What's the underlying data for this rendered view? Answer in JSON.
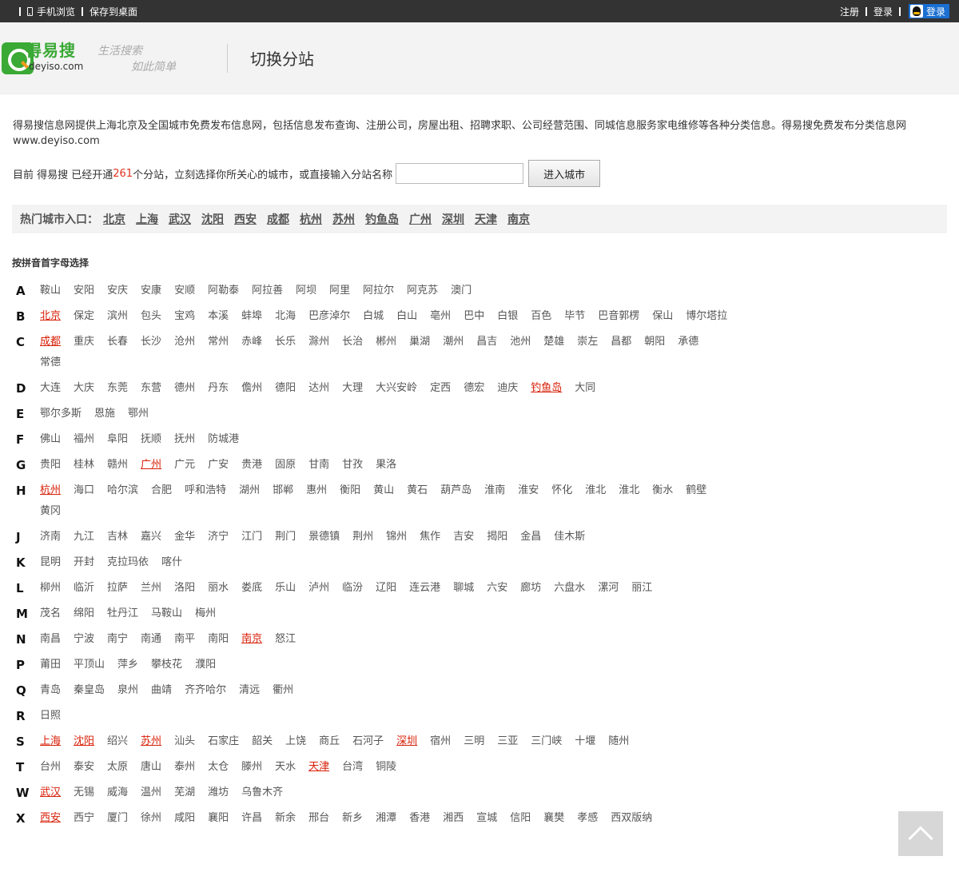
{
  "topbar": {
    "mobile": "手机浏览",
    "save_desktop": "保存到桌面",
    "register": "注册",
    "login": "登录",
    "qq_login": "登录"
  },
  "header": {
    "logo_cn": "得易搜",
    "logo_en": "deyiso.com",
    "slogan_line1": "生活搜索",
    "slogan_line2": "如此简单",
    "title": "切换分站"
  },
  "intro": {
    "text": "得易搜信息网提供上海北京及全国城市免费发布信息网，包括信息发布查询、注册公司，房屋出租、招聘求职、公司经营范围、同城信息服务家电维修等各种分类信息。得易搜免费发布分类信息网www.deyiso.com"
  },
  "search": {
    "prefix": "目前 得易搜 已经开通",
    "count": "261",
    "suffix": "个分站，立刻选择你所关心的城市，或直接输入分站名称",
    "button": "进入城市",
    "value": ""
  },
  "hot": {
    "label": "热门城市入口：",
    "cities": [
      "北京",
      "上海",
      "武汉",
      "沈阳",
      "西安",
      "成都",
      "杭州",
      "苏州",
      "钓鱼岛",
      "广州",
      "深圳",
      "天津",
      "南京"
    ]
  },
  "section_title": "按拼音首字母选择",
  "letters": [
    {
      "letter": "A",
      "cities": [
        "鞍山",
        "安阳",
        "安庆",
        "安康",
        "安顺",
        "阿勒泰",
        "阿拉善",
        "阿坝",
        "阿里",
        "阿拉尔",
        "阿克苏",
        "澳门"
      ]
    },
    {
      "letter": "B",
      "cities": [
        "北京*",
        "保定",
        "滨州",
        "包头",
        "宝鸡",
        "本溪",
        "蚌埠",
        "北海",
        "巴彦淖尔",
        "白城",
        "白山",
        "亳州",
        "巴中",
        "白银",
        "百色",
        "毕节",
        "巴音郭楞",
        "保山",
        "博尔塔拉"
      ]
    },
    {
      "letter": "C",
      "cities": [
        "成都*",
        "重庆",
        "长春",
        "长沙",
        "沧州",
        "常州",
        "赤峰",
        "长乐",
        "滁州",
        "长治",
        "郴州",
        "巢湖",
        "潮州",
        "昌吉",
        "池州",
        "楚雄",
        "崇左",
        "昌都",
        "朝阳",
        "承德",
        "常德"
      ]
    },
    {
      "letter": "D",
      "cities": [
        "大连",
        "大庆",
        "东莞",
        "东营",
        "德州",
        "丹东",
        "儋州",
        "德阳",
        "达州",
        "大理",
        "大兴安岭",
        "定西",
        "德宏",
        "迪庆",
        "钓鱼岛*",
        "大同"
      ]
    },
    {
      "letter": "E",
      "cities": [
        "鄂尔多斯",
        "恩施",
        "鄂州"
      ]
    },
    {
      "letter": "F",
      "cities": [
        "佛山",
        "福州",
        "阜阳",
        "抚顺",
        "抚州",
        "防城港"
      ]
    },
    {
      "letter": "G",
      "cities": [
        "贵阳",
        "桂林",
        "赣州",
        "广州*",
        "广元",
        "广安",
        "贵港",
        "固原",
        "甘南",
        "甘孜",
        "果洛"
      ]
    },
    {
      "letter": "H",
      "cities": [
        "杭州*",
        "海口",
        "哈尔滨",
        "合肥",
        "呼和浩特",
        "湖州",
        "邯郸",
        "惠州",
        "衡阳",
        "黄山",
        "黄石",
        "葫芦岛",
        "淮南",
        "淮安",
        "怀化",
        "淮北",
        "淮北",
        "衡水",
        "鹤壁",
        "黄冈"
      ]
    },
    {
      "letter": "J",
      "cities": [
        "济南",
        "九江",
        "吉林",
        "嘉兴",
        "金华",
        "济宁",
        "江门",
        "荆门",
        "景德镇",
        "荆州",
        "锦州",
        "焦作",
        "吉安",
        "揭阳",
        "金昌",
        "佳木斯"
      ]
    },
    {
      "letter": "K",
      "cities": [
        "昆明",
        "开封",
        "克拉玛依",
        "喀什"
      ]
    },
    {
      "letter": "L",
      "cities": [
        "柳州",
        "临沂",
        "拉萨",
        "兰州",
        "洛阳",
        "丽水",
        "娄底",
        "乐山",
        "泸州",
        "临汾",
        "辽阳",
        "连云港",
        "聊城",
        "六安",
        "廊坊",
        "六盘水",
        "漯河",
        "丽江"
      ]
    },
    {
      "letter": "M",
      "cities": [
        "茂名",
        "绵阳",
        "牡丹江",
        "马鞍山",
        "梅州"
      ]
    },
    {
      "letter": "N",
      "cities": [
        "南昌",
        "宁波",
        "南宁",
        "南通",
        "南平",
        "南阳",
        "南京*",
        "怒江"
      ]
    },
    {
      "letter": "P",
      "cities": [
        "莆田",
        "平顶山",
        "萍乡",
        "攀枝花",
        "濮阳"
      ]
    },
    {
      "letter": "Q",
      "cities": [
        "青岛",
        "秦皇岛",
        "泉州",
        "曲靖",
        "齐齐哈尔",
        "清远",
        "衢州"
      ]
    },
    {
      "letter": "R",
      "cities": [
        "日照"
      ]
    },
    {
      "letter": "S",
      "cities": [
        "上海*",
        "沈阳*",
        "绍兴",
        "苏州*",
        "汕头",
        "石家庄",
        "韶关",
        "上饶",
        "商丘",
        "石河子",
        "深圳*",
        "宿州",
        "三明",
        "三亚",
        "三门峡",
        "十堰",
        "随州"
      ]
    },
    {
      "letter": "T",
      "cities": [
        "台州",
        "泰安",
        "太原",
        "唐山",
        "泰州",
        "太仓",
        "滕州",
        "天水",
        "天津*",
        "台湾",
        "铜陵"
      ]
    },
    {
      "letter": "W",
      "cities": [
        "武汉*",
        "无锡",
        "威海",
        "温州",
        "芜湖",
        "潍坊",
        "乌鲁木齐"
      ]
    },
    {
      "letter": "X",
      "cities": [
        "西安*",
        "西宁",
        "厦门",
        "徐州",
        "咸阳",
        "襄阳",
        "许昌",
        "新余",
        "邢台",
        "新乡",
        "湘潭",
        "香港",
        "湘西",
        "宣城",
        "信阳",
        "襄樊",
        "孝感",
        "西双版纳"
      ]
    }
  ],
  "colors": {
    "topbar_bg": "#333333",
    "hot_city": "#d81e06",
    "count": "#e0301e",
    "brand_green": "#3aa935"
  }
}
